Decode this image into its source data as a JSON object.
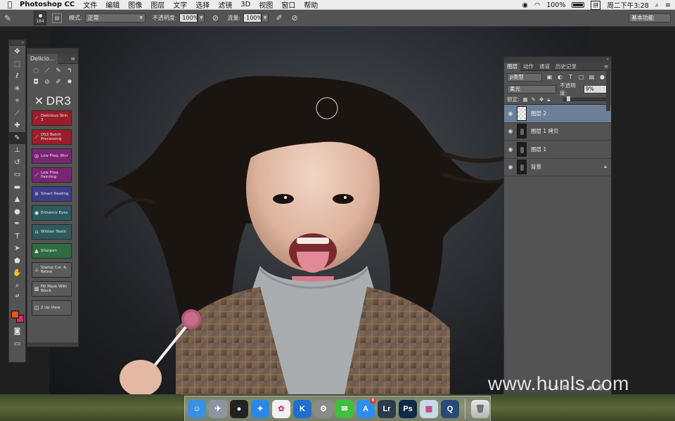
{
  "menubar": {
    "app_name": "Photoshop CC",
    "menus": [
      "文件",
      "编辑",
      "图像",
      "图层",
      "文字",
      "选择",
      "滤镜",
      "3D",
      "视图",
      "窗口",
      "帮助"
    ],
    "battery": "100%",
    "input_method": "拼",
    "clock": "周二下午3:28"
  },
  "options_bar": {
    "brush_size": "184",
    "mode_label": "模式:",
    "mode_value": "正常",
    "opacity_label": "不透明度:",
    "opacity_value": "100%",
    "flow_label": "流量:",
    "flow_value": "100%",
    "workspace": "基本功能"
  },
  "plugin_panel": {
    "tab": "Delicio...",
    "logo_text": "DR3",
    "buttons": [
      {
        "label": "Delicious Skin 3",
        "color": "red",
        "icon": "brush-icon"
      },
      {
        "label": "DS3 Batch Processing",
        "color": "red",
        "icon": "brush-icon"
      },
      {
        "label": "Low Freq. Blur",
        "color": "purple",
        "icon": "blur-icon"
      },
      {
        "label": "Low Freq. Painting",
        "color": "purple",
        "icon": "brush-icon"
      },
      {
        "label": "Smart Healing",
        "color": "violet",
        "icon": "bandage-icon"
      },
      {
        "label": "Enhance Eyes",
        "color": "teal",
        "icon": "eye-icon"
      },
      {
        "label": "Whiten Teeth",
        "color": "teal",
        "icon": "tooth-icon"
      },
      {
        "label": "Sharpen",
        "color": "green",
        "icon": "triangle-icon"
      },
      {
        "label": "Stamp Cur. & Below",
        "color": "gray",
        "icon": "stamp-icon"
      },
      {
        "label": "Fill Mask With Black",
        "color": "gray",
        "icon": "fill-icon"
      },
      {
        "label": "2 Up View",
        "color": "gray",
        "icon": "split-view-icon"
      }
    ]
  },
  "layers_panel": {
    "tabs": [
      "图层",
      "动作",
      "通道",
      "历史记录"
    ],
    "kind_filter": "ρ类型",
    "blend_mode": "柔光",
    "opacity_label": "不透明度:",
    "opacity_value": "9%",
    "lock_label": "锁定:",
    "layers": [
      {
        "name": "图层 2",
        "selected": true,
        "thumb": "transparent",
        "locked": false
      },
      {
        "name": "图层 1 拷贝",
        "selected": false,
        "thumb": "photo",
        "locked": false
      },
      {
        "name": "图层 1",
        "selected": false,
        "thumb": "photo",
        "locked": false
      },
      {
        "name": "背景",
        "selected": false,
        "thumb": "photo",
        "locked": true
      }
    ]
  },
  "colors": {
    "foreground": "#e9531c",
    "background": "#d62c6a",
    "selected_layer": "#6c7f99"
  },
  "watermark": "www.hunls.com",
  "dock": {
    "apps": [
      {
        "name": "Finder",
        "icon": "finder-icon",
        "color": "#3a8fe0",
        "glyph": "☺"
      },
      {
        "name": "Launchpad",
        "icon": "rocket-icon",
        "color": "#8c96a3",
        "glyph": "✈"
      },
      {
        "name": "QQ",
        "icon": "penguin-icon",
        "color": "#222222",
        "glyph": "●"
      },
      {
        "name": "Safari",
        "icon": "compass-icon",
        "color": "#2b88e6",
        "glyph": "✦"
      },
      {
        "name": "Photos",
        "icon": "flower-icon",
        "color": "#f2f2f2",
        "glyph": "✿"
      },
      {
        "name": "Kuaibo",
        "icon": "k-icon",
        "color": "#1f6fd0",
        "glyph": "K"
      },
      {
        "name": "System Preferences",
        "icon": "gear-icon",
        "color": "#8a8a8a",
        "glyph": "⚙"
      },
      {
        "name": "WeChat",
        "icon": "chat-icon",
        "color": "#3fbf3f",
        "glyph": "✉"
      },
      {
        "name": "App Store",
        "icon": "app-store-icon",
        "color": "#2b8ef0",
        "glyph": "A",
        "badge": "6"
      },
      {
        "name": "Lightroom",
        "icon": "lightroom-icon",
        "color": "#2c3b4c",
        "glyph": "Lr"
      },
      {
        "name": "Photoshop",
        "icon": "photoshop-icon",
        "color": "#0f2a44",
        "glyph": "Ps"
      },
      {
        "name": "Preview",
        "icon": "preview-icon",
        "color": "#c8d8e8",
        "glyph": "▦"
      },
      {
        "name": "QuickTime",
        "icon": "quicktime-icon",
        "color": "#274a78",
        "glyph": "Q"
      }
    ],
    "trash_icon": "trash-icon"
  }
}
